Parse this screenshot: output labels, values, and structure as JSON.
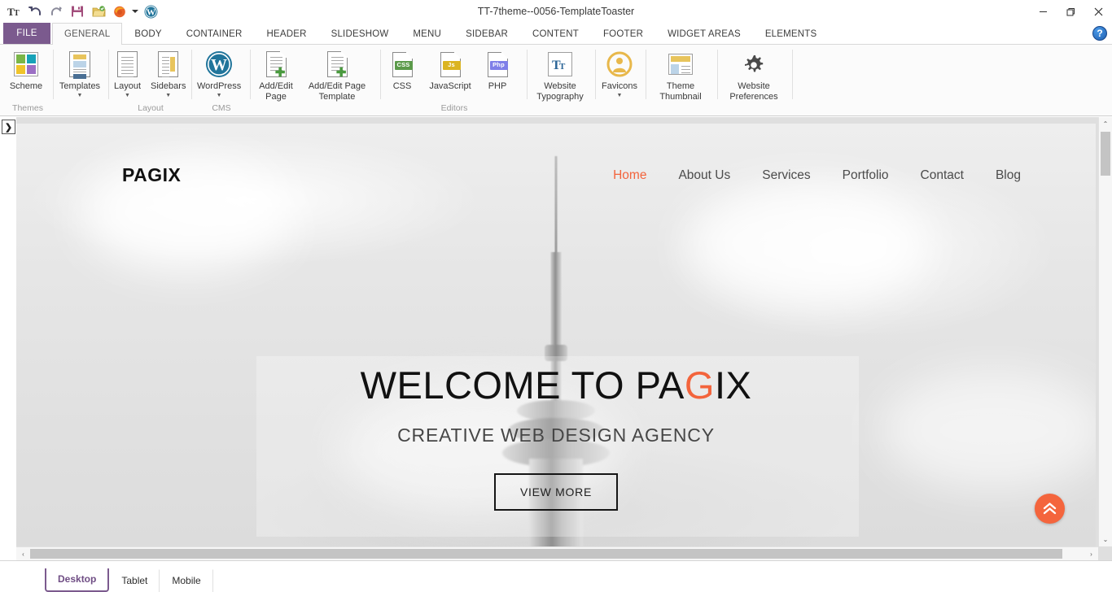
{
  "window": {
    "title": "TT-7theme--0056-TemplateToaster",
    "controls": {
      "minimize": "—",
      "restore": "❐",
      "close": "✕",
      "help": "?"
    }
  },
  "quick_access": [
    {
      "name": "tt-logo-icon",
      "glyph": "T"
    },
    {
      "name": "undo-icon",
      "glyph": "↶"
    },
    {
      "name": "redo-icon",
      "glyph": "↷"
    },
    {
      "name": "save-icon",
      "glyph": "▤"
    },
    {
      "name": "open-folder-icon",
      "glyph": "📂"
    },
    {
      "name": "firefox-preview-icon",
      "glyph": "◉"
    },
    {
      "name": "preview-dropdown-icon",
      "glyph": "▾"
    },
    {
      "name": "wordpress-icon",
      "glyph": "W"
    }
  ],
  "tabs": {
    "file": "FILE",
    "items": [
      {
        "label": "GENERAL",
        "active": true
      },
      {
        "label": "BODY",
        "active": false
      },
      {
        "label": "CONTAINER",
        "active": false
      },
      {
        "label": "HEADER",
        "active": false
      },
      {
        "label": "SLIDESHOW",
        "active": false
      },
      {
        "label": "MENU",
        "active": false
      },
      {
        "label": "SIDEBAR",
        "active": false
      },
      {
        "label": "CONTENT",
        "active": false
      },
      {
        "label": "FOOTER",
        "active": false
      },
      {
        "label": "WIDGET AREAS",
        "active": false
      },
      {
        "label": "ELEMENTS",
        "active": false
      }
    ]
  },
  "ribbon": {
    "groups": [
      {
        "label": "Themes",
        "buttons": [
          {
            "label": "Scheme",
            "icon": "color-scheme-icon",
            "caret": false
          }
        ]
      },
      {
        "label": "",
        "buttons": [
          {
            "label": "Templates",
            "icon": "templates-icon",
            "caret": true
          }
        ]
      },
      {
        "label": "Layout",
        "buttons": [
          {
            "label": "Layout",
            "icon": "layout-icon",
            "caret": true
          },
          {
            "label": "Sidebars",
            "icon": "sidebars-icon",
            "caret": true
          }
        ]
      },
      {
        "label": "CMS",
        "buttons": [
          {
            "label": "WordPress",
            "icon": "wordpress-icon",
            "caret": true
          }
        ]
      },
      {
        "label": "",
        "buttons": [
          {
            "label": "Add/Edit\nPage",
            "icon": "add-edit-page-icon",
            "caret": false
          },
          {
            "label": "Add/Edit Page\nTemplate",
            "icon": "add-edit-page-template-icon",
            "caret": false
          }
        ]
      },
      {
        "label": "Editors",
        "buttons": [
          {
            "label": "CSS",
            "icon": "css-file-icon",
            "tag": "CSS",
            "tag_color": "#5b9a4a",
            "caret": false
          },
          {
            "label": "JavaScript",
            "icon": "js-file-icon",
            "tag": "Js",
            "tag_color": "#dbb421",
            "caret": false
          },
          {
            "label": "PHP",
            "icon": "php-file-icon",
            "tag": "Php",
            "tag_color": "#7f7fe8",
            "caret": false
          }
        ]
      },
      {
        "label": "",
        "buttons": [
          {
            "label": "Website\nTypography",
            "icon": "typography-icon",
            "caret": false
          }
        ]
      },
      {
        "label": "",
        "buttons": [
          {
            "label": "Favicons",
            "icon": "favicons-icon",
            "caret": true
          }
        ]
      },
      {
        "label": "",
        "buttons": [
          {
            "label": "Theme\nThumbnail",
            "icon": "theme-thumbnail-icon",
            "caret": false
          }
        ]
      },
      {
        "label": "",
        "buttons": [
          {
            "label": "Website\nPreferences",
            "icon": "website-preferences-gear-icon",
            "caret": false
          }
        ]
      }
    ]
  },
  "preview": {
    "brand": "PAGIX",
    "nav": [
      {
        "label": "Home",
        "active": true
      },
      {
        "label": "About Us",
        "active": false
      },
      {
        "label": "Services",
        "active": false
      },
      {
        "label": "Portfolio",
        "active": false
      },
      {
        "label": "Contact",
        "active": false
      },
      {
        "label": "Blog",
        "active": false
      }
    ],
    "hero": {
      "title_before": "WELCOME TO PA",
      "title_accent": "G",
      "title_after": "IX",
      "subtitle": "CREATIVE WEB DESIGN AGENCY",
      "button": "VIEW MORE"
    },
    "scroll_top_icon": "⌃⌃",
    "accent_color": "#f3643c"
  },
  "bottom": {
    "devices": [
      {
        "label": "Desktop",
        "active": true
      },
      {
        "label": "Tablet",
        "active": false
      },
      {
        "label": "Mobile",
        "active": false
      }
    ]
  },
  "scrollbars": {
    "up": "⌃",
    "down": "⌄",
    "left": "‹",
    "right": "›"
  },
  "panel_toggle_icon": "❯"
}
